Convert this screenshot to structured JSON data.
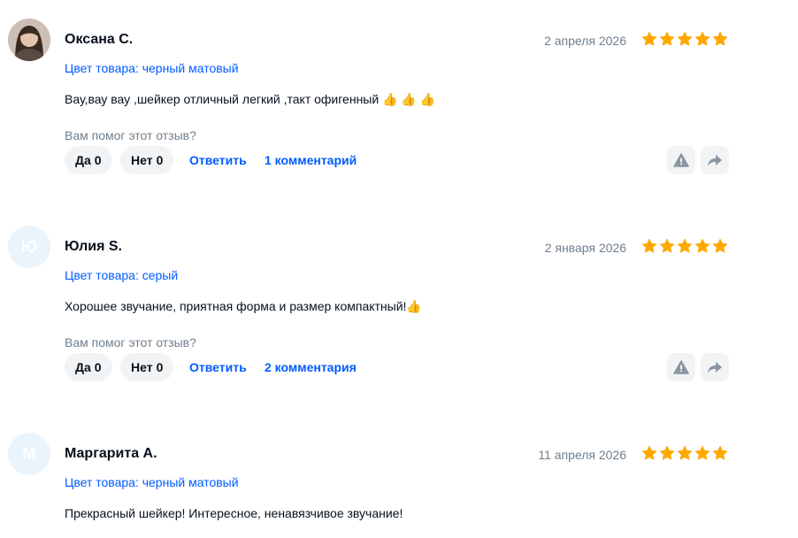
{
  "reviews": [
    {
      "author": "Оксана С.",
      "avatar_letter": "",
      "date": "2 апреля 2026",
      "rating": 5,
      "variant": "Цвет товара: черный матовый",
      "text": "Вау,вау вау ,шейкер отличный легкий ,такт офигенный 👍 👍 👍",
      "helpful_prompt": "Вам помог этот отзыв?",
      "yes_label": "Да",
      "yes_count": "0",
      "no_label": "Нет",
      "no_count": "0",
      "reply_label": "Ответить",
      "comments_label": "1 комментарий"
    },
    {
      "author": "Юлия S.",
      "avatar_letter": "Ю",
      "date": "2 января 2026",
      "rating": 5,
      "variant": "Цвет товара: серый",
      "text": "Хорошее звучание, приятная форма и размер компактный!👍",
      "helpful_prompt": "Вам помог этот отзыв?",
      "yes_label": "Да",
      "yes_count": "0",
      "no_label": "Нет",
      "no_count": "0",
      "reply_label": "Ответить",
      "comments_label": "2 комментария"
    },
    {
      "author": "Маргарита А.",
      "avatar_letter": "М",
      "date": "11 апреля 2026",
      "rating": 5,
      "variant": "Цвет товара: черный матовый",
      "text": "Прекрасный шейкер! Интересное, ненавязчивое звучание!"
    }
  ],
  "colors": {
    "star": "#ffa800",
    "link": "#005bff",
    "muted": "#707f8d",
    "chip_bg": "#f2f3f5",
    "avatar_bg": "#eaf4fc"
  },
  "icons": {
    "star": "star-icon",
    "report": "alert-triangle-icon",
    "share": "share-arrow-icon"
  }
}
